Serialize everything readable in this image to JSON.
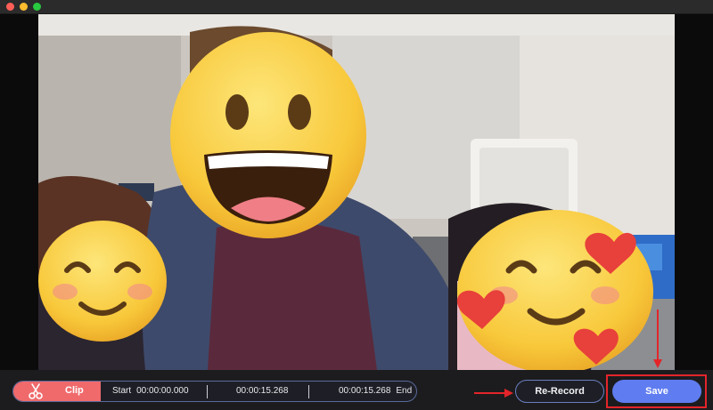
{
  "window": {
    "traffic_lights": [
      "close",
      "minimize",
      "maximize"
    ]
  },
  "video": {
    "description_icons": [
      "grinning-face-emoji",
      "smiling-face-emoji",
      "smiling-face-with-hearts-emoji"
    ]
  },
  "clip_bar": {
    "clip_label": "Clip",
    "start_label": "Start",
    "start_time": "00:00:00.000",
    "duration_time": "00:00:15.268",
    "end_time": "00:00:15.268",
    "end_label": "End",
    "scissors_icon": "scissors-icon"
  },
  "actions": {
    "rerecord_label": "Re-Record",
    "save_label": "Save"
  },
  "colors": {
    "clip_accent": "#f06a6c",
    "save_accent": "#5f7cf0",
    "highlight": "#e3252a"
  }
}
